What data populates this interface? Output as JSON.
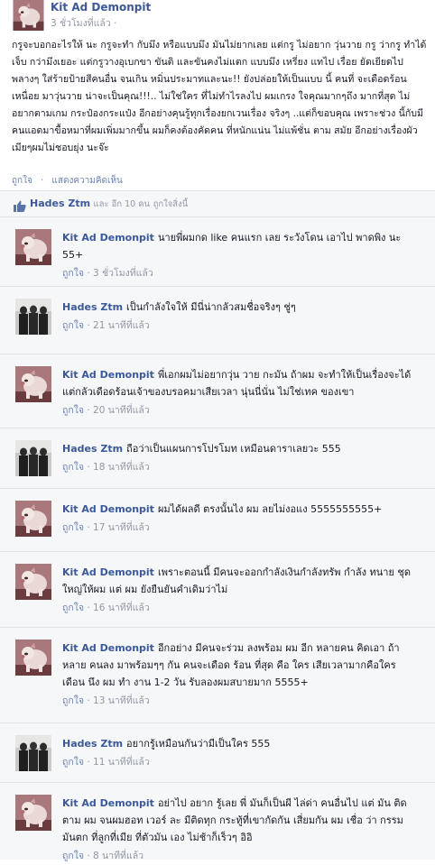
{
  "post": {
    "author": "Kit Ad Demonpit",
    "time": "3 ชั่วโมงที่แล้ว ·",
    "text": "กรูจะบอกอะไรให้ นะ กรูจะทำ กับมึง หรือแบบมึง มันไม่ยากเลย แต่กรู ไม่อยาก วุ่นวาย กรู ว่ากรู ทำได้เจ็บ กว่ามึงเยอะ แต่กรูวางอุเบกขา ขันติ และขันคงไม่แตก แบบมึง เหรี่ยง แทไป เรื่อย ยัดเยียดไป พลางๆ ใส่ร้ายป้ายสีคนอื่น จนเกิน หมิ่นประมาทและนะ!! ยังปล่อยให้เป็นแบบ นี้ คนที่ จะเดือดร้อน เหนื่อย มาวุ่นวาย น่าจะเป็นคุณ!!!.. ไม่ใช่ใคร ที่ไม่ทำไรลงไป ผมเกรง ใจคุณมากๆถึง มากที่สุด ไม่อยากตามเกม กระป๋องกระแป๋ง อีกอย่างคุนรู้ทุกเรื่องยกเวนเรื่อง จริงๆ ..แต่ก็ขอบคุณ เพราะช่วง นี้กับมีคนแอดมาขื้อหมาที่ผมเพิ่มมากขึ้น ผมก็คงต้องคัดคน ที่หนักแน่น ไม่แพ้ชั่น ตาม สมัย อีกอย่างเรื่องผัวเมียๆผมไม่ชอบยุ่ง นะจ๊ะ",
    "actions": [
      "ถูกใจ",
      "·",
      "แสดงความคิดเห็น"
    ]
  },
  "likes": {
    "name": "Hades Ztm",
    "rest": "และ อีก 10 คน",
    "suffix": "ถูกใจสิ่งนี้"
  },
  "comments": [
    {
      "author": "Kit Ad Demonpit",
      "avatar": "dog",
      "text": "นายพี่ผมกด like คนแรก เลย ระวังโดน เอาไป พาดพิง นะ 55+",
      "like": "ถูกใจ",
      "time": "· 3 ชั่วโมงที่แล้ว"
    },
    {
      "author": "Hades Ztm",
      "avatar": "group",
      "text": "เป็นกำลังใจให้ มีนี่น่ากลัวสมชื่อจริงๆ ชู่ๆ",
      "like": "ถูกใจ",
      "time": "· 21 นาทีที่แล้ว"
    },
    {
      "author": "Kit Ad Demonpit",
      "avatar": "dog",
      "text": "พี่เอกผมไม่อยากวุ่น วาย กะมัน ถ้าผม จะทำให้เป็นเรื่องจะได้ แต่กลัวเดือดร้อนเจ้าของบรอคมาเสียเวลา นุ่นนี่นั่น ไม่ใช่เทค ของเขา",
      "like": "ถูกใจ",
      "time": "· 20 นาทีที่แล้ว"
    },
    {
      "author": "Hades Ztm",
      "avatar": "group",
      "text": "ถือว่าเป็นแผนการโปรโมท เหมือนดาราเลยวะ 555",
      "like": "ถูกใจ",
      "time": "· 18 นาทีที่แล้ว"
    },
    {
      "author": "Kit Ad Demonpit",
      "avatar": "dog",
      "text": "ผมได้ผลดี ตรงนั้นไง ผม ลยไม่งอแง 5555555555+",
      "like": "ถูกใจ",
      "time": "· 17 นาทีที่แล้ว"
    },
    {
      "author": "Kit Ad Demonpit",
      "avatar": "dog",
      "text": "เพราะตอนนี้ มีคนจะออกกำลังเงินกำลังทรัพ กำลัง ทนาย ชุด ใหญ่ให้ผม แต่ ผม ยังยืนยันคำเดิมว่าไม่",
      "like": "ถูกใจ",
      "time": "· 16 นาทีที่แล้ว"
    },
    {
      "author": "Kit Ad Demonpit",
      "avatar": "dog",
      "text": "อีกอย่าง มีคนจะร่วม ลงพร้อม ผม อีก หลายคน คิดเอา ถ้า หลาย คนลง มาพร้อมๆๆ กัน คนจะเดือด ร้อน ที่สุด คือ ใคร เสียเวลามากคือใคร เดือน นึง ผม ทำ งาน 1-2 วัน รับลองผมสบายมาก 5555+",
      "like": "ถูกใจ",
      "time": "· 13 นาทีที่แล้ว"
    },
    {
      "author": "Hades Ztm",
      "avatar": "group",
      "text": "อยากรู้เหมือนกันว่ามีเป็นใคร 555",
      "like": "ถูกใจ",
      "time": "· 11 นาทีที่แล้ว"
    },
    {
      "author": "Kit Ad Demonpit",
      "avatar": "dog",
      "text": "อย่าไป อยาก รู้เลย พี่ มันก็เป็นผี ไล่ด่า คนอื่นไป แต่ มัน ติด ตาม ผม จนผมฮอท เวอร์ ละ มีติดทุก กระทู้ที่เขากัดกัน เสี่ยมกัน ผม เชื่อ ว่า กรรม มันตก ที่ลูกที่เมีย ที่ตัวมัน เอง ไม่ช้าก็เร็วๆ อิอิ",
      "like": "ถูกใจ",
      "time": "· 8 นาทีที่แล้ว"
    }
  ]
}
